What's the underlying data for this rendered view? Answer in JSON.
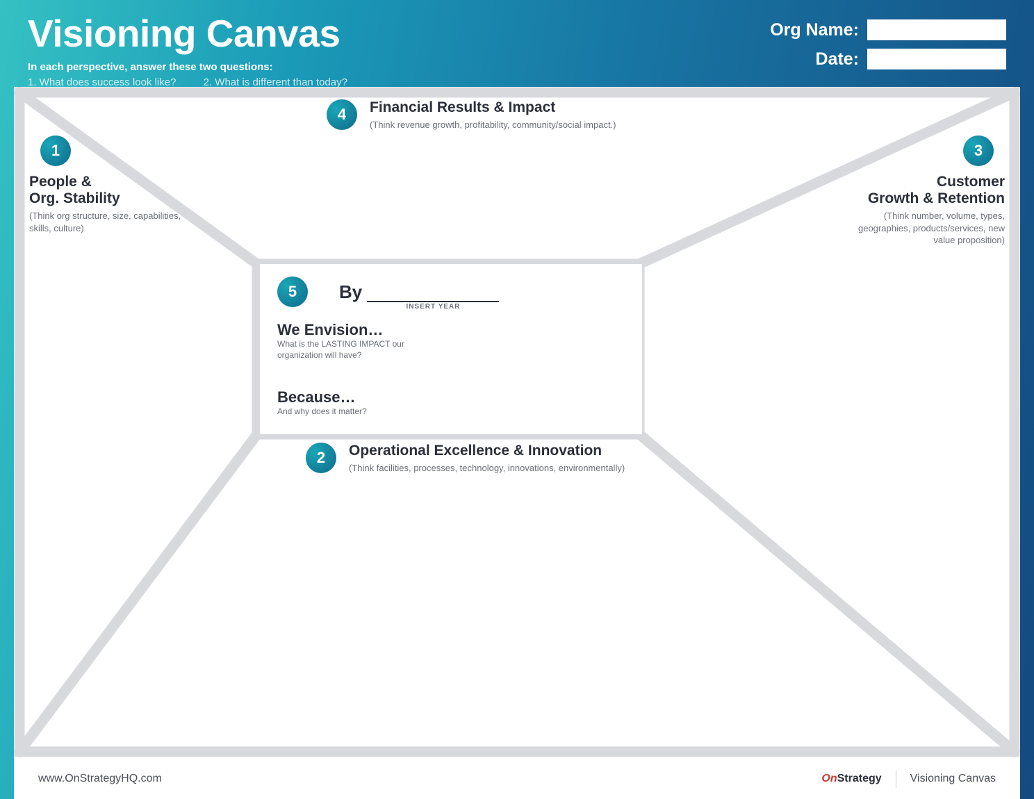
{
  "header": {
    "title": "Visioning Canvas",
    "subtitle": "In each perspective, answer these two questions:",
    "question1": "1. What does success look like?",
    "question2": "2. What is different than today?",
    "org_label": "Org Name:",
    "date_label": "Date:",
    "org_value": "",
    "date_value": ""
  },
  "sections": {
    "top": {
      "number": "4",
      "title": "Financial Results & Impact",
      "hint": "(Think revenue growth, profitability, community/social impact.)"
    },
    "left": {
      "number": "1",
      "title_line1": "People &",
      "title_line2": "Org. Stability",
      "hint": "(Think org structure, size, capabilities, skills, culture)"
    },
    "right": {
      "number": "3",
      "title_line1": "Customer",
      "title_line2": "Growth & Retention",
      "hint": "(Think number, volume, types, geographies, products/services, new value proposition)"
    },
    "bottom": {
      "number": "2",
      "title": "Operational Excellence & Innovation",
      "hint": "(Think facilities, processes, technology, innovations, environmentally)"
    },
    "center": {
      "number": "5",
      "by_label": "By",
      "insert_year": "INSERT YEAR",
      "envision_title": "We Envision…",
      "envision_sub": "What is the LASTING IMPACT our organization will have?",
      "because_title": "Because…",
      "because_sub": "And why does it matter?"
    }
  },
  "footer": {
    "url": "www.OnStrategyHQ.com",
    "brand_part1": "On",
    "brand_part2": "Strategy",
    "doc_name": "Visioning Canvas"
  }
}
